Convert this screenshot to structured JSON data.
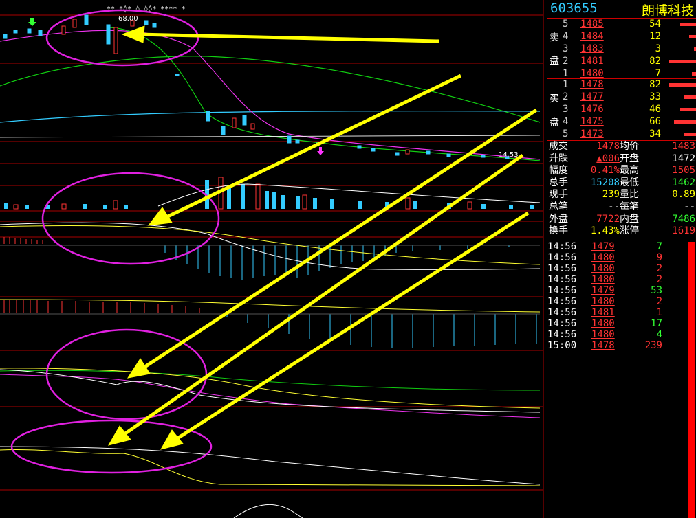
{
  "stock": {
    "code": "603655",
    "name": "朗博科技"
  },
  "chart_labels": {
    "high": "68.00",
    "low": "14.53"
  },
  "markers_top": "** *◊* ◊ ◊◊* **** *",
  "side_labels": {
    "sell": [
      "卖",
      "盘"
    ],
    "buy": [
      "买",
      "盘"
    ]
  },
  "sell_orders": [
    {
      "level": "5",
      "price": "1485",
      "volume": "54",
      "bar": 0.55
    },
    {
      "level": "4",
      "price": "1484",
      "volume": "12",
      "bar": 0.25
    },
    {
      "level": "3",
      "price": "1483",
      "volume": "3",
      "bar": 0.1
    },
    {
      "level": "2",
      "price": "1481",
      "volume": "82",
      "bar": 0.9
    },
    {
      "level": "1",
      "price": "1480",
      "volume": "7",
      "bar": 0.15
    }
  ],
  "buy_orders": [
    {
      "level": "1",
      "price": "1478",
      "volume": "82",
      "bar": 0.9
    },
    {
      "level": "2",
      "price": "1477",
      "volume": "33",
      "bar": 0.4
    },
    {
      "level": "3",
      "price": "1476",
      "volume": "46",
      "bar": 0.55
    },
    {
      "level": "4",
      "price": "1475",
      "volume": "66",
      "bar": 0.75
    },
    {
      "level": "5",
      "price": "1473",
      "volume": "34",
      "bar": 0.4
    }
  ],
  "quote": [
    {
      "l1": "成交",
      "v1": "1478",
      "l2": "均价",
      "v2": "1483",
      "c1": "#f33",
      "c2": "#f33",
      "u1": true
    },
    {
      "l1": "升跌",
      "v1": "▲006",
      "l2": "开盘",
      "v2": "1472",
      "c1": "#f33",
      "c2": "#fff",
      "u1": true
    },
    {
      "l1": "幅度",
      "v1": "0.41%",
      "l2": "最高",
      "v2": "1505",
      "c1": "#f33",
      "c2": "#f33",
      "u1": false
    },
    {
      "l1": "总手",
      "v1": "15208",
      "l2": "最低",
      "v2": "1462",
      "c1": "#3cf",
      "c2": "#3f3",
      "u1": false
    },
    {
      "l1": "现手",
      "v1": "239",
      "l2": "量比",
      "v2": "0.89",
      "c1": "#ff0",
      "c2": "#ff0",
      "u1": false
    },
    {
      "l1": "总笔",
      "v1": "--",
      "l2": "每笔",
      "v2": "--",
      "c1": "#ccc",
      "c2": "#ccc",
      "u1": false
    },
    {
      "l1": "外盘",
      "v1": "7722",
      "l2": "内盘",
      "v2": "7486",
      "c1": "#f33",
      "c2": "#3f3",
      "u1": false
    },
    {
      "l1": "换手",
      "v1": "1.43%",
      "l2": "涨停",
      "v2": "1619",
      "c1": "#ff0",
      "c2": "#f33",
      "u1": false
    }
  ],
  "ticks": [
    {
      "time": "14:56",
      "price": "1479",
      "vol": "7",
      "vc": "#3f3"
    },
    {
      "time": "14:56",
      "price": "1480",
      "vol": "9",
      "vc": "#f33"
    },
    {
      "time": "14:56",
      "price": "1480",
      "vol": "2",
      "vc": "#f33"
    },
    {
      "time": "14:56",
      "price": "1480",
      "vol": "2",
      "vc": "#f33"
    },
    {
      "time": "14:56",
      "price": "1479",
      "vol": "53",
      "vc": "#3f3"
    },
    {
      "time": "14:56",
      "price": "1480",
      "vol": "2",
      "vc": "#f33"
    },
    {
      "time": "14:56",
      "price": "1481",
      "vol": "1",
      "vc": "#f33"
    },
    {
      "time": "14:56",
      "price": "1480",
      "vol": "17",
      "vc": "#3f3"
    },
    {
      "time": "14:56",
      "price": "1480",
      "vol": "4",
      "vc": "#3f3"
    },
    {
      "time": "15:00",
      "price": "1478",
      "vol": "239",
      "vc": "#f33"
    }
  ]
}
